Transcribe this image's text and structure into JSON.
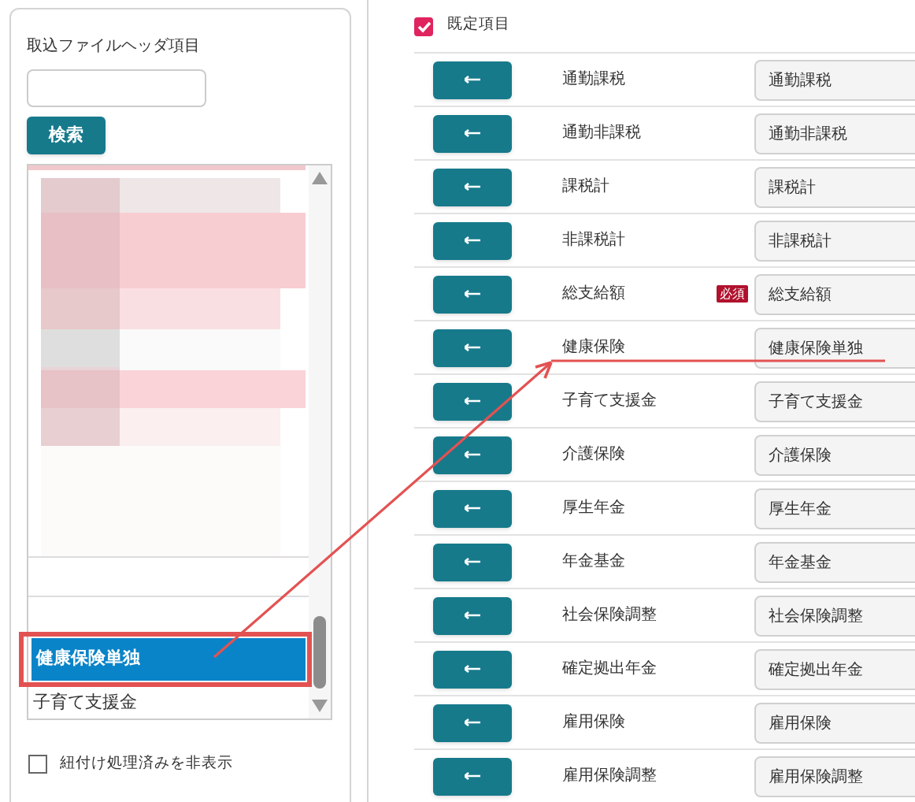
{
  "left_panel": {
    "title": "取込ファイルヘッダ項目",
    "search_button": "検索",
    "list": [
      {
        "label": "健康保険単独",
        "selected": true
      },
      {
        "label": "子育て支援金",
        "selected": false
      }
    ],
    "hide_linked": {
      "label": "紐付け処理済みを非表示",
      "checked": false
    }
  },
  "right_panel": {
    "default_items": {
      "label": "既定項目",
      "checked": true
    },
    "rows": [
      {
        "label": "通勤課税",
        "value": "通勤課税"
      },
      {
        "label": "通勤非課税",
        "value": "通勤非課税"
      },
      {
        "label": "課税計",
        "value": "課税計"
      },
      {
        "label": "非課税計",
        "value": "非課税計"
      },
      {
        "label": "総支給額",
        "badge": "必須",
        "value": "総支給額"
      },
      {
        "label": "健康保険",
        "value": "健康保険単独"
      },
      {
        "label": "子育て支援金",
        "value": "子育て支援金"
      },
      {
        "label": "介護保険",
        "value": "介護保険"
      },
      {
        "label": "厚生年金",
        "value": "厚生年金"
      },
      {
        "label": "年金基金",
        "value": "年金基金"
      },
      {
        "label": "社会保険調整",
        "value": "社会保険調整"
      },
      {
        "label": "確定拠出年金",
        "value": "確定拠出年金"
      },
      {
        "label": "雇用保険",
        "value": "雇用保険"
      },
      {
        "label": "雇用保険調整",
        "value": "雇用保険調整"
      }
    ]
  }
}
